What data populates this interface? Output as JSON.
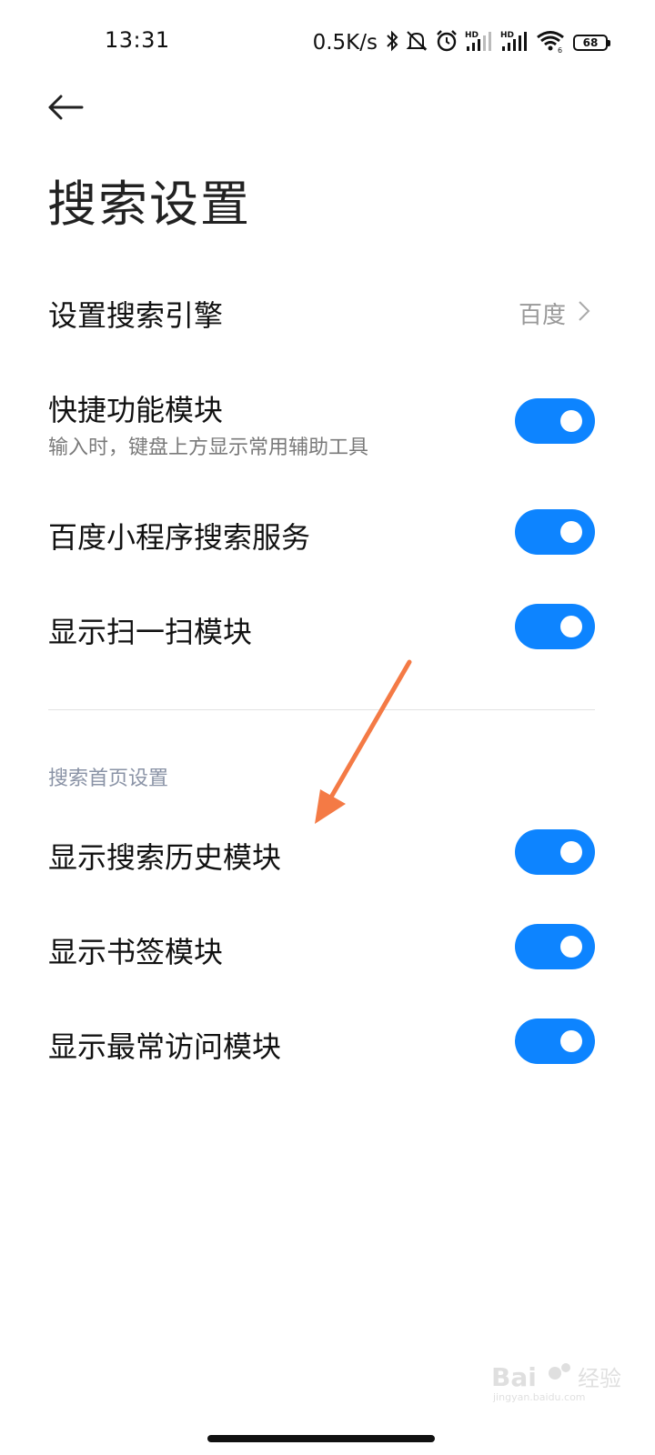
{
  "status_bar": {
    "time": "13:31",
    "net_speed": "0.5K/s",
    "battery": "68",
    "icons": [
      "bluetooth-icon",
      "mute-icon",
      "alarm-icon",
      "hd-signal-icon",
      "hd-signal-icon",
      "wifi-icon",
      "battery-icon"
    ]
  },
  "header": {
    "back_icon": "arrow-left-icon",
    "title": "搜索设置"
  },
  "settings": {
    "search_engine": {
      "label": "设置搜索引擎",
      "value": "百度"
    },
    "quick_module": {
      "label": "快捷功能模块",
      "description": "输入时，键盘上方显示常用辅助工具",
      "enabled": true
    },
    "mini_program": {
      "label": "百度小程序搜索服务",
      "enabled": true
    },
    "scan_module": {
      "label": "显示扫一扫模块",
      "enabled": true
    }
  },
  "homepage_section": {
    "header": "搜索首页设置",
    "history_module": {
      "label": "显示搜索历史模块",
      "enabled": true
    },
    "bookmark_module": {
      "label": "显示书签模块",
      "enabled": true
    },
    "frequent_module": {
      "label": "显示最常访问模块",
      "enabled": true
    }
  },
  "colors": {
    "accent": "#0d84ff",
    "annotation_arrow": "#f47a45",
    "section_header": "#8a93a6"
  },
  "watermark": {
    "text": "Bai 经验",
    "subtext": "jingyan.baidu.com"
  }
}
